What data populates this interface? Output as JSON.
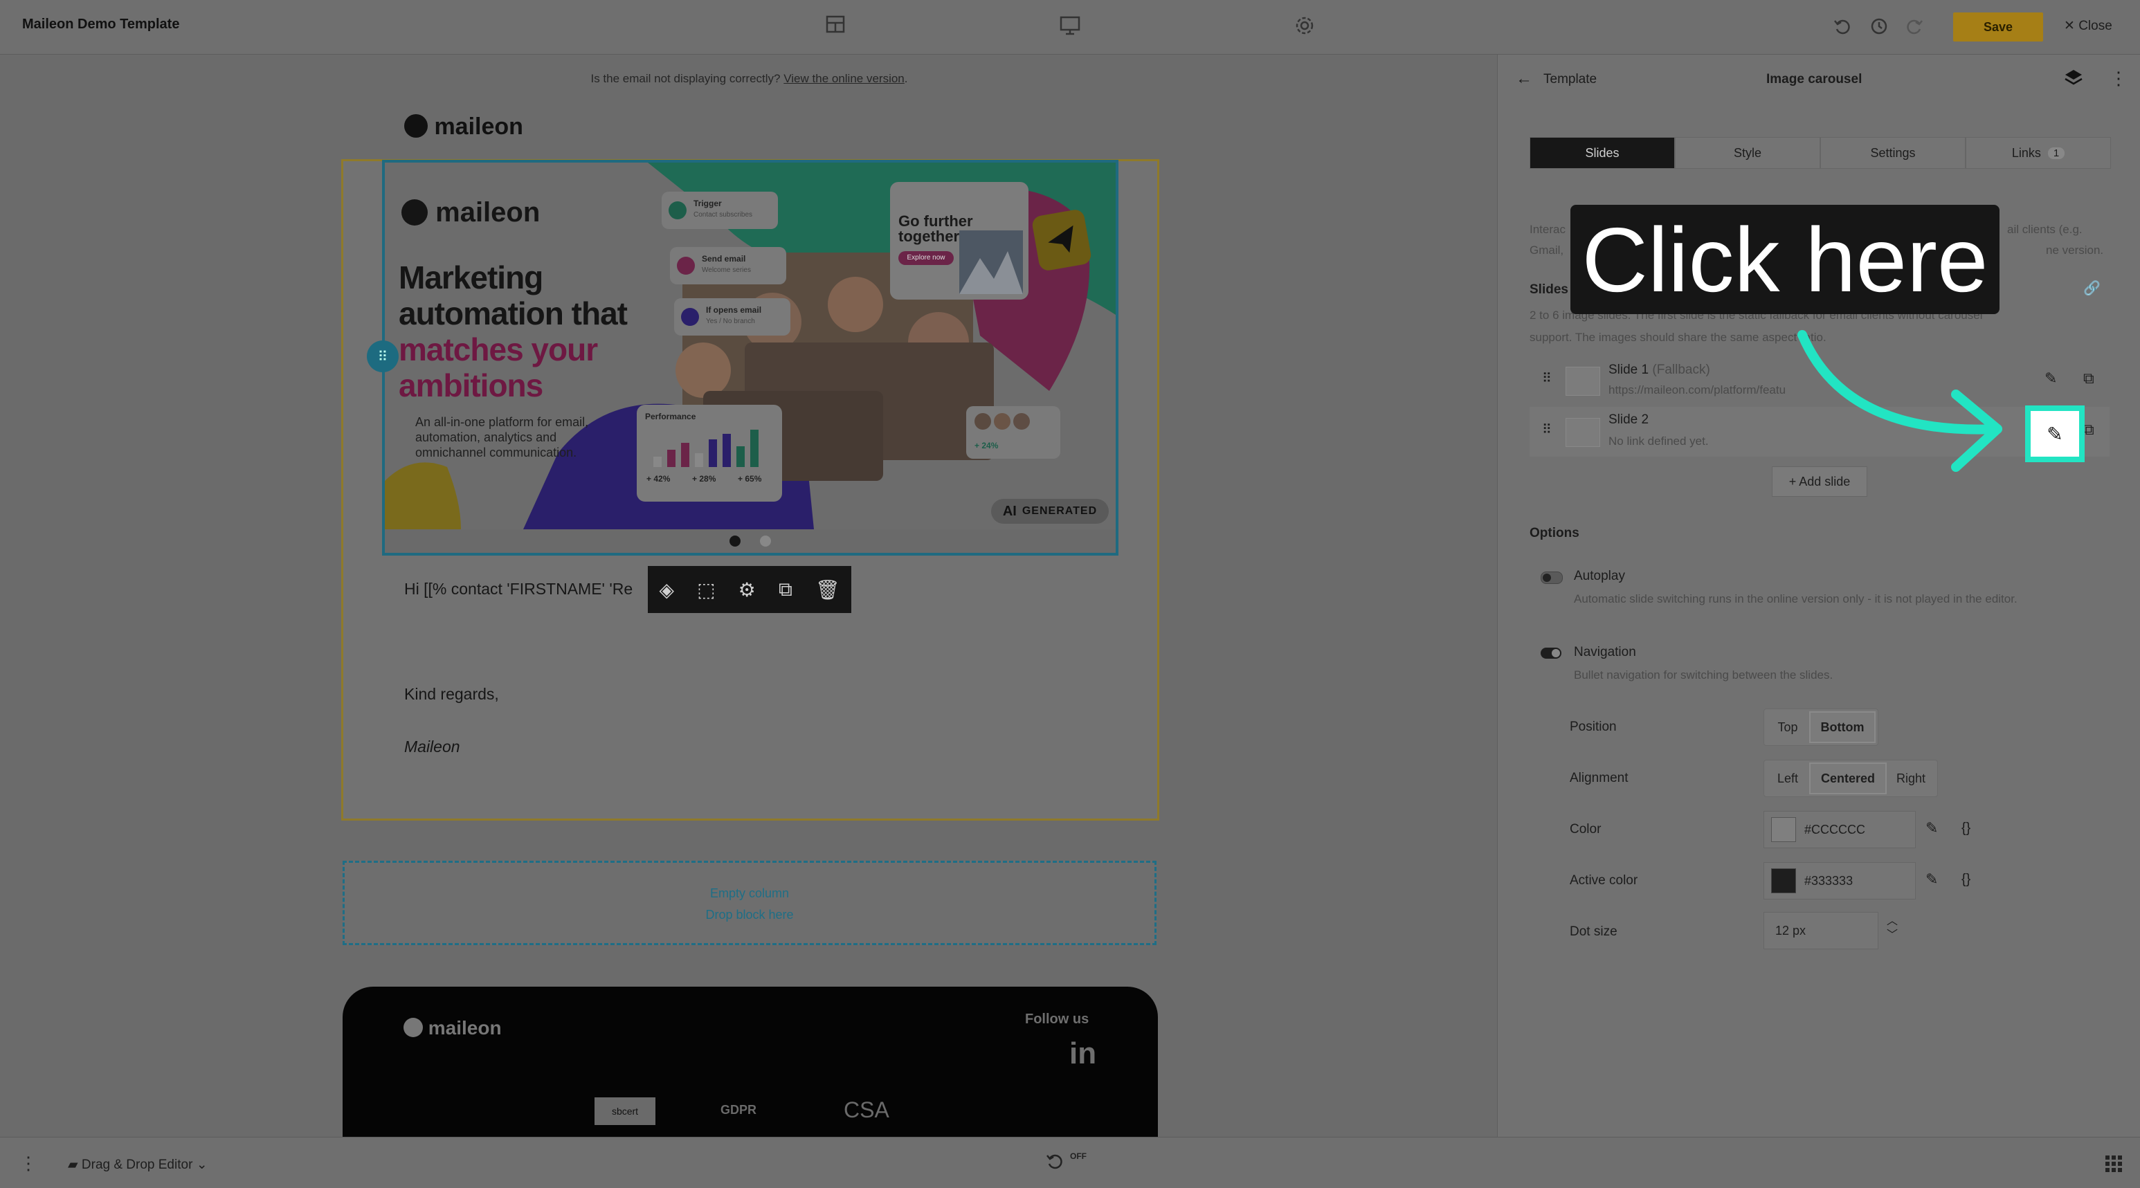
{
  "app": {
    "title": "Maileon Demo Template"
  },
  "toolbar": {
    "layout_icon": "layout-icon",
    "desktop_icon": "desktop-icon",
    "settings_icon": "settings-icon",
    "undo_icon": "undo-icon",
    "history_icon": "history-icon",
    "redo_icon": "redo-icon",
    "save_label": "Save",
    "close_label": "Close"
  },
  "email": {
    "notice_text": "Is the email not displaying correctly?",
    "notice_link": "View the online version",
    "logo_text": "maileon",
    "hero": {
      "brand": "maileon",
      "headline_1": "Marketing",
      "headline_2": "automation that",
      "headline_3": "matches your",
      "headline_4": "ambitions",
      "sub_1": "An all-in-one platform for email,",
      "sub_2": "automation, analytics and",
      "sub_3": "omnichannel communication.",
      "card1": "Trigger",
      "card1_sub": "Contact subscribes",
      "card2": "Send email",
      "card2_sub": "Welcome series",
      "card3": "If opens email",
      "card3_sub": "Yes / No branch",
      "promo_title_1": "Go further",
      "promo_title_2": "together",
      "promo_button": "Explore now",
      "perf_title": "Performance",
      "perf_stats": [
        "+ 42%",
        "+ 28%",
        "+ 65%"
      ],
      "audience_stat": "+ 24%",
      "ai_badge": "GENERATED",
      "ai_prefix": "AI"
    },
    "greeting": "Hi [[% contact 'FIRSTNAME' 'Re",
    "closing": "Kind regards,",
    "signature": "Maileon",
    "empty_column": "Empty column",
    "drop_here": "Drop block here",
    "footer": {
      "logo_text": "maileon",
      "follow_us": "Follow us",
      "social": "in",
      "badge_1": "sbcert",
      "badge_2": "GDPR",
      "badge_3": "CSA"
    }
  },
  "bottombar": {
    "mode_label": "Drag & Drop Editor",
    "off_label": "OFF"
  },
  "panel": {
    "back_label": "Template",
    "title": "Image carousel",
    "tabs": [
      {
        "label": "Slides"
      },
      {
        "label": "Style"
      },
      {
        "label": "Settings"
      },
      {
        "label": "Links"
      }
    ],
    "links_count": "1",
    "intro_1": "Interac",
    "intro_1b": "ail clients (e.g.",
    "intro_2": "Gmail,",
    "intro_2b": "ne version.",
    "slides_heading": "Slides",
    "slides_desc_1": "2 to 6 image slides. The first slide is the static fallback for email clients without carousel",
    "slides_desc_2": "support. The images should share the same aspect ratio.",
    "slides": [
      {
        "name": "Slide 1",
        "tag": "(Fallback)",
        "sub": "https://maileon.com/platform/featu"
      },
      {
        "name": "Slide 2",
        "tag": "",
        "sub": "No link defined yet."
      }
    ],
    "add_slide": "+ Add slide",
    "options_heading": "Options",
    "autoplay_label": "Autoplay",
    "autoplay_desc": "Automatic slide switching runs in the online version only - it is not played in the editor.",
    "navigation_label": "Navigation",
    "navigation_desc": "Bullet navigation for switching between the slides.",
    "position_label": "Position",
    "position_options": [
      "Top",
      "Bottom"
    ],
    "alignment_label": "Alignment",
    "alignment_options": [
      "Left",
      "Centered",
      "Right"
    ],
    "color_label": "Color",
    "color_value": "#CCCCCC",
    "active_color_label": "Active color",
    "active_color_value": "#333333",
    "dot_size_label": "Dot size",
    "dot_size_value": "12 px"
  },
  "overlay": {
    "tooltip_text": "Click here",
    "accent_color": "#22e4c3"
  },
  "colors": {
    "save": "#a67f16",
    "selection": "#1f6a80",
    "block_border": "#8f7a2a"
  }
}
